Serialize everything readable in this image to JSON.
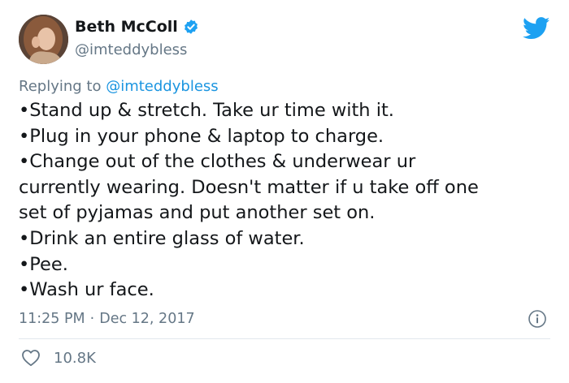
{
  "author": {
    "name": "Beth McColl",
    "handle": "@imteddybless",
    "verified": true
  },
  "reply": {
    "prefix": "Replying to",
    "mention": "@imteddybless"
  },
  "tweet": {
    "lines": [
      "•Stand up & stretch. Take ur time with it.",
      "•Plug in your phone & laptop to charge.",
      "•Change out of the clothes & underwear ur",
      "currently wearing. Doesn't matter if u take off one",
      "set of pyjamas and put another set on.",
      "•Drink an entire glass of water.",
      "•Pee.",
      "•Wash ur face."
    ]
  },
  "meta": {
    "time": "11:25 PM",
    "separator": "·",
    "date": "Dec 12, 2017"
  },
  "stats": {
    "likes": "10.8K"
  },
  "icons": {
    "brand": "twitter-bird-icon",
    "verified": "verified-badge-icon",
    "info": "info-icon",
    "like": "heart-icon"
  },
  "colors": {
    "brand": "#1da1f2",
    "link": "#1b95e0",
    "text": "#14171a",
    "secondary": "#657786",
    "divider": "#e1e8ed"
  }
}
